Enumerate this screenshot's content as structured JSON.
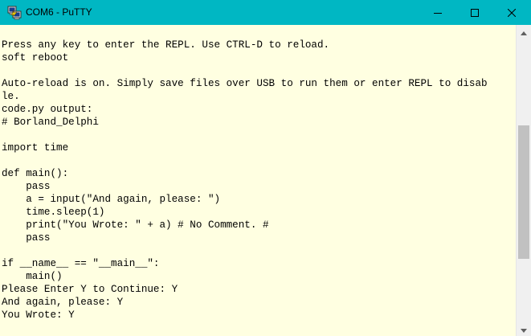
{
  "window": {
    "title": "COM6 - PuTTY",
    "app_icon": "putty-computers-icon",
    "controls": {
      "minimize_icon": "minimize-icon",
      "maximize_icon": "maximize-icon",
      "close_icon": "close-icon"
    },
    "titlebar_color": "#00b7c3"
  },
  "terminal": {
    "background_color": "#ffffe1",
    "text_color": "#000000",
    "lines": [
      "Press any key to enter the REPL. Use CTRL-D to reload.",
      "soft reboot",
      "",
      "Auto-reload is on. Simply save files over USB to run them or enter REPL to disab",
      "le.",
      "code.py output:",
      "# Borland_Delphi",
      "",
      "import time",
      "",
      "def main():",
      "    pass",
      "    a = input(\"And again, please: \")",
      "    time.sleep(1)",
      "    print(\"You Wrote: \" + a) # No Comment. #",
      "    pass",
      "",
      "if __name__ == \"__main__\":",
      "    main()",
      "Please Enter Y to Continue: Y",
      "And again, please: Y",
      "You Wrote: Y"
    ]
  },
  "scrollbar": {
    "up_icon": "scroll-up-arrow-icon",
    "down_icon": "scroll-down-arrow-icon",
    "scroll_position_fraction": 0.58
  }
}
